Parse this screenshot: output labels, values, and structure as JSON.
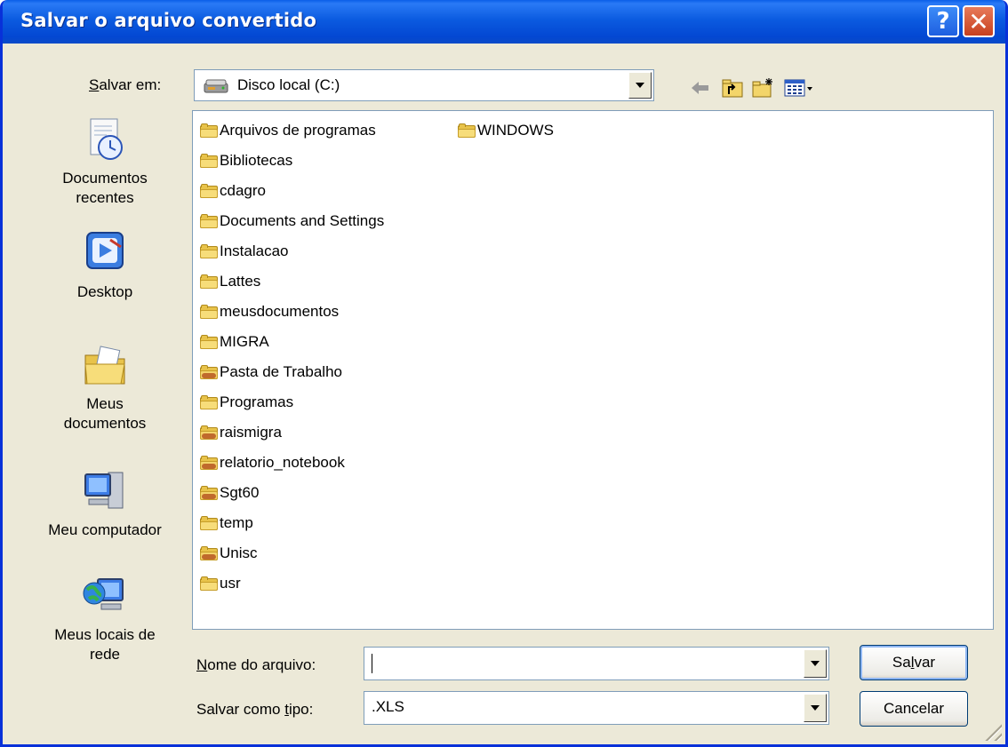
{
  "window": {
    "title": "Salvar o arquivo convertido",
    "help_label": "?",
    "close_label": "✕"
  },
  "toolbar": {
    "save_in_label": "Salvar em:",
    "save_in_mnemonic": "S",
    "save_in_rest": "alvar em:",
    "location_value": "Disco local (C:)",
    "icons": [
      "back-arrow-icon",
      "up-folder-icon",
      "new-folder-icon",
      "view-menu-icon"
    ]
  },
  "places": [
    {
      "name": "Documentos recentes",
      "line1": "Documentos",
      "line2": "recentes",
      "icon": "recent-documents-icon"
    },
    {
      "name": "Desktop",
      "line1": "Desktop",
      "line2": "",
      "icon": "desktop-icon"
    },
    {
      "name": "Meus documentos",
      "line1": "Meus",
      "line2": "documentos",
      "icon": "my-documents-icon"
    },
    {
      "name": "Meu computador",
      "line1": "Meu computador",
      "line2": "",
      "icon": "my-computer-icon"
    },
    {
      "name": "Meus locais de rede",
      "line1": "Meus locais de",
      "line2": "rede",
      "icon": "network-places-icon"
    }
  ],
  "files": [
    {
      "name": "Arquivos de programas",
      "type": "folder"
    },
    {
      "name": "Bibliotecas",
      "type": "folder"
    },
    {
      "name": "cdagro",
      "type": "folder"
    },
    {
      "name": "Documents and Settings",
      "type": "folder"
    },
    {
      "name": "Instalacao",
      "type": "folder"
    },
    {
      "name": "Lattes",
      "type": "folder"
    },
    {
      "name": "meusdocumentos",
      "type": "folder"
    },
    {
      "name": "MIGRA",
      "type": "folder"
    },
    {
      "name": "Pasta de Trabalho",
      "type": "shared-folder"
    },
    {
      "name": "Programas",
      "type": "folder"
    },
    {
      "name": "raismigra",
      "type": "shared-folder"
    },
    {
      "name": "relatorio_notebook",
      "type": "shared-folder"
    },
    {
      "name": "Sgt60",
      "type": "shared-folder"
    },
    {
      "name": "temp",
      "type": "folder"
    },
    {
      "name": "Unisc",
      "type": "shared-folder"
    },
    {
      "name": "usr",
      "type": "folder"
    },
    {
      "name": "WINDOWS",
      "type": "folder"
    }
  ],
  "form": {
    "filename_label_mnemonic": "N",
    "filename_label_rest": "ome do arquivo:",
    "filename_value": "",
    "filetype_label_pre": "Salvar como ",
    "filetype_label_mnemonic": "t",
    "filetype_label_rest": "ipo:",
    "filetype_value": ".XLS"
  },
  "buttons": {
    "save_pre": "Sa",
    "save_mnemonic": "l",
    "save_rest": "var",
    "cancel": "Cancelar"
  },
  "colors": {
    "titlebar": "#0A5BE0",
    "dialog_bg": "#ECE9D8",
    "close_button": "#D5532F"
  }
}
